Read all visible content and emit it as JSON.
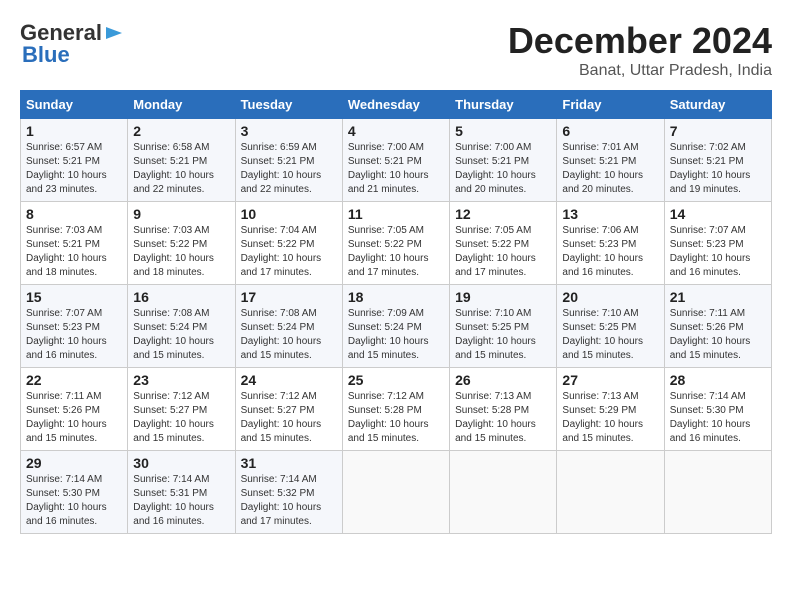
{
  "header": {
    "logo_general": "General",
    "logo_blue": "Blue",
    "month_title": "December 2024",
    "subtitle": "Banat, Uttar Pradesh, India"
  },
  "calendar": {
    "days_of_week": [
      "Sunday",
      "Monday",
      "Tuesday",
      "Wednesday",
      "Thursday",
      "Friday",
      "Saturday"
    ],
    "weeks": [
      [
        {
          "day": "",
          "info": ""
        },
        {
          "day": "2",
          "info": "Sunrise: 6:58 AM\nSunset: 5:21 PM\nDaylight: 10 hours\nand 22 minutes."
        },
        {
          "day": "3",
          "info": "Sunrise: 6:59 AM\nSunset: 5:21 PM\nDaylight: 10 hours\nand 22 minutes."
        },
        {
          "day": "4",
          "info": "Sunrise: 7:00 AM\nSunset: 5:21 PM\nDaylight: 10 hours\nand 21 minutes."
        },
        {
          "day": "5",
          "info": "Sunrise: 7:00 AM\nSunset: 5:21 PM\nDaylight: 10 hours\nand 20 minutes."
        },
        {
          "day": "6",
          "info": "Sunrise: 7:01 AM\nSunset: 5:21 PM\nDaylight: 10 hours\nand 20 minutes."
        },
        {
          "day": "7",
          "info": "Sunrise: 7:02 AM\nSunset: 5:21 PM\nDaylight: 10 hours\nand 19 minutes."
        }
      ],
      [
        {
          "day": "1",
          "info": "Sunrise: 6:57 AM\nSunset: 5:21 PM\nDaylight: 10 hours\nand 23 minutes."
        },
        {
          "day": "",
          "info": ""
        },
        {
          "day": "",
          "info": ""
        },
        {
          "day": "",
          "info": ""
        },
        {
          "day": "",
          "info": ""
        },
        {
          "day": "",
          "info": ""
        },
        {
          "day": "",
          "info": ""
        }
      ],
      [
        {
          "day": "8",
          "info": "Sunrise: 7:03 AM\nSunset: 5:21 PM\nDaylight: 10 hours\nand 18 minutes."
        },
        {
          "day": "9",
          "info": "Sunrise: 7:03 AM\nSunset: 5:22 PM\nDaylight: 10 hours\nand 18 minutes."
        },
        {
          "day": "10",
          "info": "Sunrise: 7:04 AM\nSunset: 5:22 PM\nDaylight: 10 hours\nand 17 minutes."
        },
        {
          "day": "11",
          "info": "Sunrise: 7:05 AM\nSunset: 5:22 PM\nDaylight: 10 hours\nand 17 minutes."
        },
        {
          "day": "12",
          "info": "Sunrise: 7:05 AM\nSunset: 5:22 PM\nDaylight: 10 hours\nand 17 minutes."
        },
        {
          "day": "13",
          "info": "Sunrise: 7:06 AM\nSunset: 5:23 PM\nDaylight: 10 hours\nand 16 minutes."
        },
        {
          "day": "14",
          "info": "Sunrise: 7:07 AM\nSunset: 5:23 PM\nDaylight: 10 hours\nand 16 minutes."
        }
      ],
      [
        {
          "day": "15",
          "info": "Sunrise: 7:07 AM\nSunset: 5:23 PM\nDaylight: 10 hours\nand 16 minutes."
        },
        {
          "day": "16",
          "info": "Sunrise: 7:08 AM\nSunset: 5:24 PM\nDaylight: 10 hours\nand 15 minutes."
        },
        {
          "day": "17",
          "info": "Sunrise: 7:08 AM\nSunset: 5:24 PM\nDaylight: 10 hours\nand 15 minutes."
        },
        {
          "day": "18",
          "info": "Sunrise: 7:09 AM\nSunset: 5:24 PM\nDaylight: 10 hours\nand 15 minutes."
        },
        {
          "day": "19",
          "info": "Sunrise: 7:10 AM\nSunset: 5:25 PM\nDaylight: 10 hours\nand 15 minutes."
        },
        {
          "day": "20",
          "info": "Sunrise: 7:10 AM\nSunset: 5:25 PM\nDaylight: 10 hours\nand 15 minutes."
        },
        {
          "day": "21",
          "info": "Sunrise: 7:11 AM\nSunset: 5:26 PM\nDaylight: 10 hours\nand 15 minutes."
        }
      ],
      [
        {
          "day": "22",
          "info": "Sunrise: 7:11 AM\nSunset: 5:26 PM\nDaylight: 10 hours\nand 15 minutes."
        },
        {
          "day": "23",
          "info": "Sunrise: 7:12 AM\nSunset: 5:27 PM\nDaylight: 10 hours\nand 15 minutes."
        },
        {
          "day": "24",
          "info": "Sunrise: 7:12 AM\nSunset: 5:27 PM\nDaylight: 10 hours\nand 15 minutes."
        },
        {
          "day": "25",
          "info": "Sunrise: 7:12 AM\nSunset: 5:28 PM\nDaylight: 10 hours\nand 15 minutes."
        },
        {
          "day": "26",
          "info": "Sunrise: 7:13 AM\nSunset: 5:28 PM\nDaylight: 10 hours\nand 15 minutes."
        },
        {
          "day": "27",
          "info": "Sunrise: 7:13 AM\nSunset: 5:29 PM\nDaylight: 10 hours\nand 15 minutes."
        },
        {
          "day": "28",
          "info": "Sunrise: 7:14 AM\nSunset: 5:30 PM\nDaylight: 10 hours\nand 16 minutes."
        }
      ],
      [
        {
          "day": "29",
          "info": "Sunrise: 7:14 AM\nSunset: 5:30 PM\nDaylight: 10 hours\nand 16 minutes."
        },
        {
          "day": "30",
          "info": "Sunrise: 7:14 AM\nSunset: 5:31 PM\nDaylight: 10 hours\nand 16 minutes."
        },
        {
          "day": "31",
          "info": "Sunrise: 7:14 AM\nSunset: 5:32 PM\nDaylight: 10 hours\nand 17 minutes."
        },
        {
          "day": "",
          "info": ""
        },
        {
          "day": "",
          "info": ""
        },
        {
          "day": "",
          "info": ""
        },
        {
          "day": "",
          "info": ""
        }
      ]
    ]
  }
}
